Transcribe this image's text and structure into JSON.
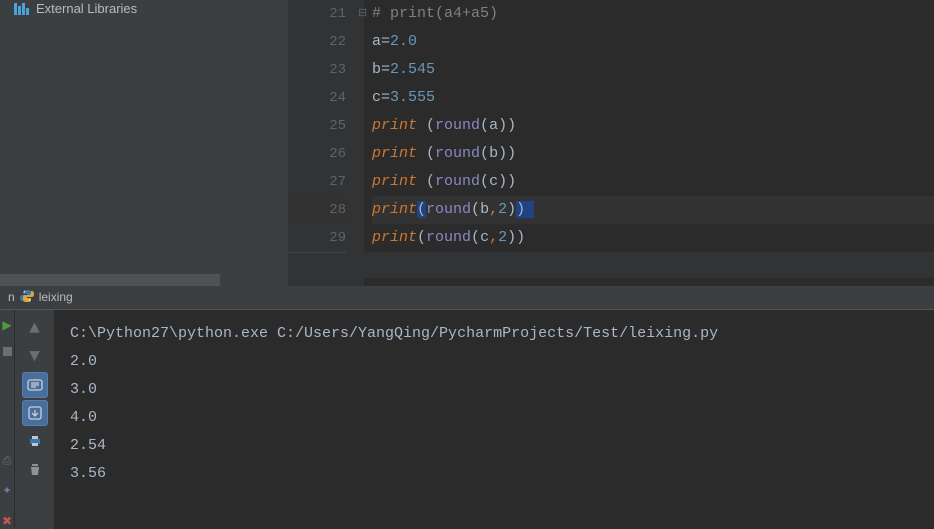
{
  "sidebar": {
    "external_libraries_label": "External Libraries"
  },
  "editor": {
    "gutter": [
      "21",
      "22",
      "23",
      "24",
      "25",
      "26",
      "27",
      "28",
      "29"
    ],
    "lines": {
      "l21_comment": "# print(a4+a5)",
      "l22_var": "a",
      "l22_val": "2.0",
      "l23_var": "b",
      "l23_val": "2.545",
      "l24_var": "c",
      "l24_val": "3.555",
      "kw_print": "print",
      "fn_round": "round",
      "arg_a": "a",
      "arg_b": "b",
      "arg_c": "c",
      "arg_2": "2"
    }
  },
  "run_tab": {
    "prefix": "n",
    "name": "leixing"
  },
  "console": {
    "cmd": "C:\\Python27\\python.exe C:/Users/YangQing/PycharmProjects/Test/leixing.py",
    "out1": "2.0",
    "out2": "3.0",
    "out3": "4.0",
    "out4": "2.54",
    "out5": "3.56"
  },
  "icons": {
    "arrow_up": "▲",
    "arrow_down": "▼",
    "play": "▶"
  }
}
